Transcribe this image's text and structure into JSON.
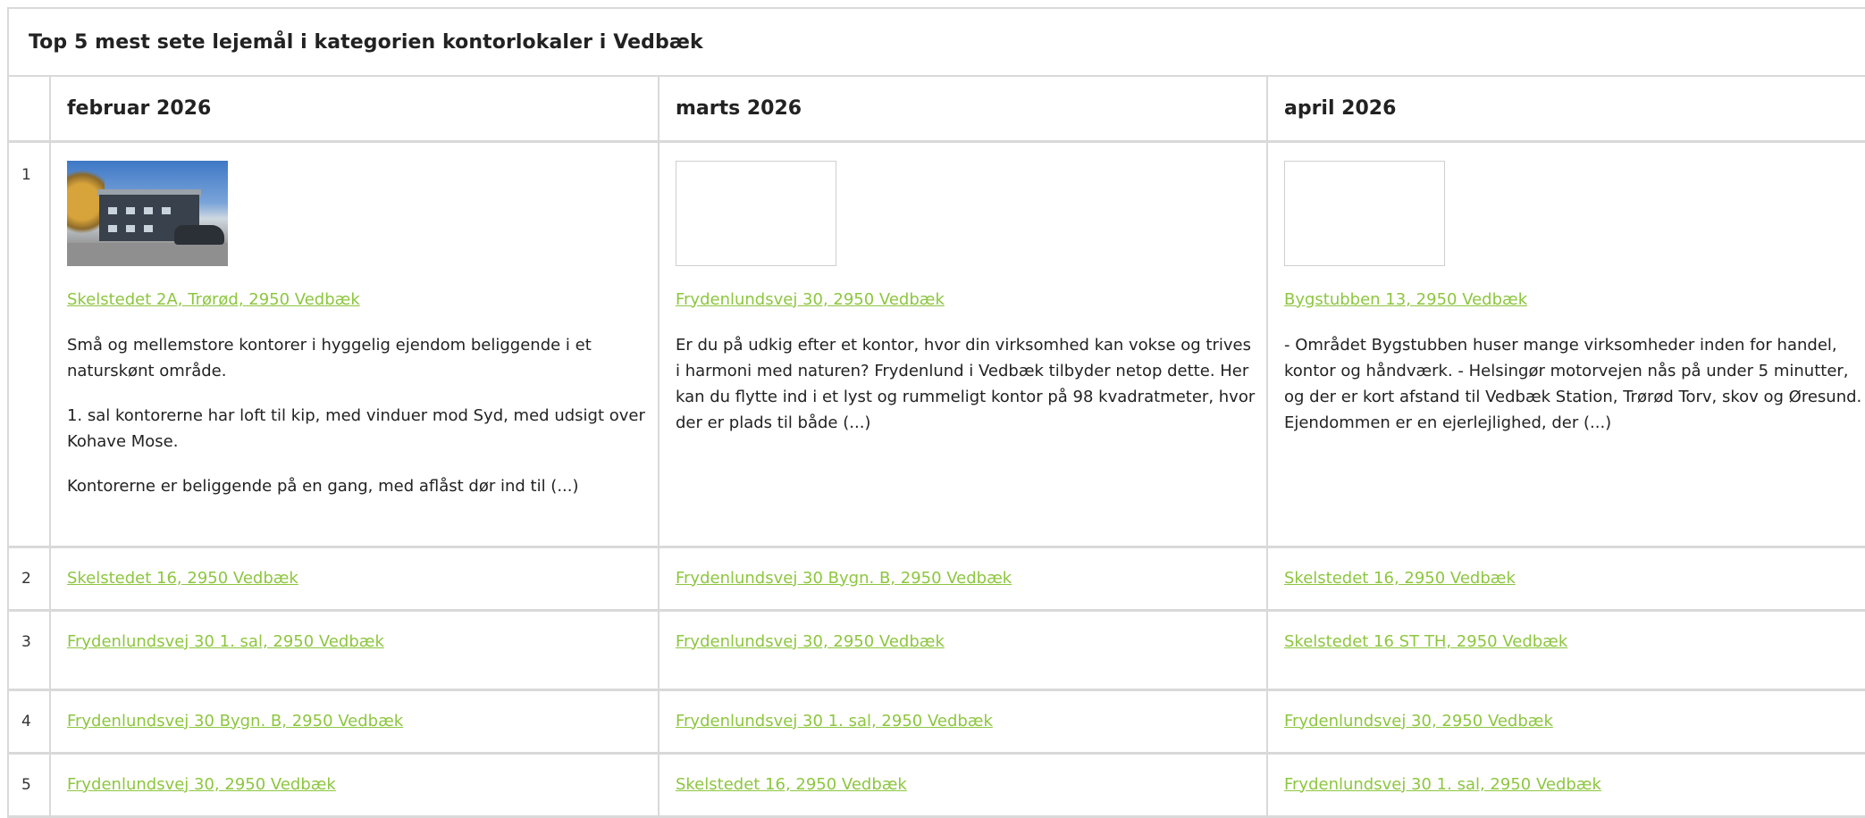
{
  "title": "Top 5 mest sete lejemål i kategorien kontorlokaler i Vedbæk",
  "months": [
    "februar 2026",
    "marts 2026",
    "april 2026"
  ],
  "rank1": [
    {
      "image": "office-building-photo",
      "address": "Skelstedet 2A, Trørød, 2950 Vedbæk",
      "paragraphs": [
        "Små og mellemstore kontorer i hyggelig ejendom beliggende i et naturskønt område.",
        "1. sal kontorerne har loft til kip, med vinduer mod Syd, med udsigt over Kohave Mose.",
        "Kontorerne er beliggende på en gang, med aflåst dør ind til (...)"
      ]
    },
    {
      "image": "empty-placeholder",
      "address": "Frydenlundsvej 30, 2950 Vedbæk",
      "paragraphs": [
        "Er du på udkig efter et kontor, hvor din virksomhed kan vokse og trives i harmoni med naturen? Frydenlund i Vedbæk tilbyder netop dette. Her kan du flytte ind i et lyst og rummeligt kontor på 98 kvadratmeter, hvor der er plads til både (...)"
      ]
    },
    {
      "image": "empty-placeholder",
      "address": "Bygstubben 13, 2950 Vedbæk",
      "paragraphs": [
        "- Området Bygstubben huser mange virksomheder inden for handel, kontor og håndværk. - Helsingør motorvejen nås på under 5 minutter, og der er kort afstand til Vedbæk Station, Trørød Torv, skov og Øresund. - Ejendommen er en ejerlejlighed, der (...)"
      ]
    }
  ],
  "rows": [
    {
      "rank": "2",
      "addresses": [
        "Skelstedet 16, 2950 Vedbæk",
        "Frydenlundsvej 30 Bygn. B, 2950 Vedbæk",
        "Skelstedet 16, 2950 Vedbæk"
      ]
    },
    {
      "rank": "3",
      "addresses": [
        "Frydenlundsvej 30 1. sal, 2950 Vedbæk",
        "Frydenlundsvej 30, 2950 Vedbæk",
        "Skelstedet 16 ST TH, 2950 Vedbæk"
      ]
    },
    {
      "rank": "4",
      "addresses": [
        "Frydenlundsvej 30 Bygn. B, 2950 Vedbæk",
        "Frydenlundsvej 30 1. sal, 2950 Vedbæk",
        "Frydenlundsvej 30, 2950 Vedbæk"
      ]
    },
    {
      "rank": "5",
      "addresses": [
        "Frydenlundsvej 30, 2950 Vedbæk",
        "Skelstedet 16, 2950 Vedbæk",
        "Frydenlundsvej 30 1. sal, 2950 Vedbæk"
      ]
    }
  ],
  "rank1_label": "1",
  "colors": {
    "link": "#8dc63f",
    "border": "#d9d9d9",
    "text": "#222222"
  }
}
